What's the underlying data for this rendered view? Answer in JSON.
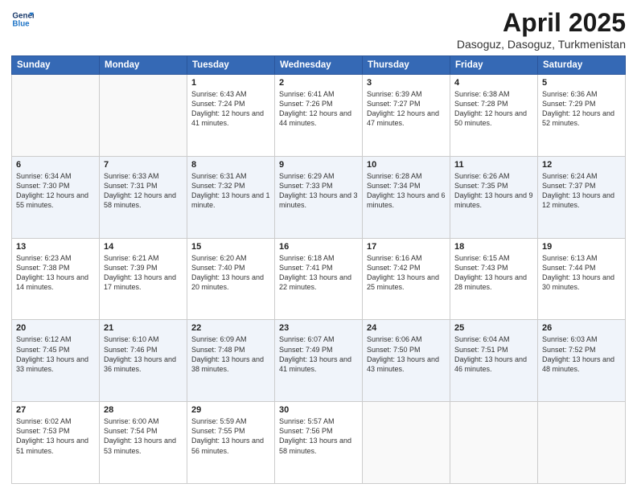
{
  "header": {
    "logo_line1": "General",
    "logo_line2": "Blue",
    "title": "April 2025",
    "subtitle": "Dasoguz, Dasoguz, Turkmenistan"
  },
  "weekdays": [
    "Sunday",
    "Monday",
    "Tuesday",
    "Wednesday",
    "Thursday",
    "Friday",
    "Saturday"
  ],
  "weeks": [
    [
      {
        "day": "",
        "sunrise": "",
        "sunset": "",
        "daylight": ""
      },
      {
        "day": "",
        "sunrise": "",
        "sunset": "",
        "daylight": ""
      },
      {
        "day": "1",
        "sunrise": "Sunrise: 6:43 AM",
        "sunset": "Sunset: 7:24 PM",
        "daylight": "Daylight: 12 hours and 41 minutes."
      },
      {
        "day": "2",
        "sunrise": "Sunrise: 6:41 AM",
        "sunset": "Sunset: 7:26 PM",
        "daylight": "Daylight: 12 hours and 44 minutes."
      },
      {
        "day": "3",
        "sunrise": "Sunrise: 6:39 AM",
        "sunset": "Sunset: 7:27 PM",
        "daylight": "Daylight: 12 hours and 47 minutes."
      },
      {
        "day": "4",
        "sunrise": "Sunrise: 6:38 AM",
        "sunset": "Sunset: 7:28 PM",
        "daylight": "Daylight: 12 hours and 50 minutes."
      },
      {
        "day": "5",
        "sunrise": "Sunrise: 6:36 AM",
        "sunset": "Sunset: 7:29 PM",
        "daylight": "Daylight: 12 hours and 52 minutes."
      }
    ],
    [
      {
        "day": "6",
        "sunrise": "Sunrise: 6:34 AM",
        "sunset": "Sunset: 7:30 PM",
        "daylight": "Daylight: 12 hours and 55 minutes."
      },
      {
        "day": "7",
        "sunrise": "Sunrise: 6:33 AM",
        "sunset": "Sunset: 7:31 PM",
        "daylight": "Daylight: 12 hours and 58 minutes."
      },
      {
        "day": "8",
        "sunrise": "Sunrise: 6:31 AM",
        "sunset": "Sunset: 7:32 PM",
        "daylight": "Daylight: 13 hours and 1 minute."
      },
      {
        "day": "9",
        "sunrise": "Sunrise: 6:29 AM",
        "sunset": "Sunset: 7:33 PM",
        "daylight": "Daylight: 13 hours and 3 minutes."
      },
      {
        "day": "10",
        "sunrise": "Sunrise: 6:28 AM",
        "sunset": "Sunset: 7:34 PM",
        "daylight": "Daylight: 13 hours and 6 minutes."
      },
      {
        "day": "11",
        "sunrise": "Sunrise: 6:26 AM",
        "sunset": "Sunset: 7:35 PM",
        "daylight": "Daylight: 13 hours and 9 minutes."
      },
      {
        "day": "12",
        "sunrise": "Sunrise: 6:24 AM",
        "sunset": "Sunset: 7:37 PM",
        "daylight": "Daylight: 13 hours and 12 minutes."
      }
    ],
    [
      {
        "day": "13",
        "sunrise": "Sunrise: 6:23 AM",
        "sunset": "Sunset: 7:38 PM",
        "daylight": "Daylight: 13 hours and 14 minutes."
      },
      {
        "day": "14",
        "sunrise": "Sunrise: 6:21 AM",
        "sunset": "Sunset: 7:39 PM",
        "daylight": "Daylight: 13 hours and 17 minutes."
      },
      {
        "day": "15",
        "sunrise": "Sunrise: 6:20 AM",
        "sunset": "Sunset: 7:40 PM",
        "daylight": "Daylight: 13 hours and 20 minutes."
      },
      {
        "day": "16",
        "sunrise": "Sunrise: 6:18 AM",
        "sunset": "Sunset: 7:41 PM",
        "daylight": "Daylight: 13 hours and 22 minutes."
      },
      {
        "day": "17",
        "sunrise": "Sunrise: 6:16 AM",
        "sunset": "Sunset: 7:42 PM",
        "daylight": "Daylight: 13 hours and 25 minutes."
      },
      {
        "day": "18",
        "sunrise": "Sunrise: 6:15 AM",
        "sunset": "Sunset: 7:43 PM",
        "daylight": "Daylight: 13 hours and 28 minutes."
      },
      {
        "day": "19",
        "sunrise": "Sunrise: 6:13 AM",
        "sunset": "Sunset: 7:44 PM",
        "daylight": "Daylight: 13 hours and 30 minutes."
      }
    ],
    [
      {
        "day": "20",
        "sunrise": "Sunrise: 6:12 AM",
        "sunset": "Sunset: 7:45 PM",
        "daylight": "Daylight: 13 hours and 33 minutes."
      },
      {
        "day": "21",
        "sunrise": "Sunrise: 6:10 AM",
        "sunset": "Sunset: 7:46 PM",
        "daylight": "Daylight: 13 hours and 36 minutes."
      },
      {
        "day": "22",
        "sunrise": "Sunrise: 6:09 AM",
        "sunset": "Sunset: 7:48 PM",
        "daylight": "Daylight: 13 hours and 38 minutes."
      },
      {
        "day": "23",
        "sunrise": "Sunrise: 6:07 AM",
        "sunset": "Sunset: 7:49 PM",
        "daylight": "Daylight: 13 hours and 41 minutes."
      },
      {
        "day": "24",
        "sunrise": "Sunrise: 6:06 AM",
        "sunset": "Sunset: 7:50 PM",
        "daylight": "Daylight: 13 hours and 43 minutes."
      },
      {
        "day": "25",
        "sunrise": "Sunrise: 6:04 AM",
        "sunset": "Sunset: 7:51 PM",
        "daylight": "Daylight: 13 hours and 46 minutes."
      },
      {
        "day": "26",
        "sunrise": "Sunrise: 6:03 AM",
        "sunset": "Sunset: 7:52 PM",
        "daylight": "Daylight: 13 hours and 48 minutes."
      }
    ],
    [
      {
        "day": "27",
        "sunrise": "Sunrise: 6:02 AM",
        "sunset": "Sunset: 7:53 PM",
        "daylight": "Daylight: 13 hours and 51 minutes."
      },
      {
        "day": "28",
        "sunrise": "Sunrise: 6:00 AM",
        "sunset": "Sunset: 7:54 PM",
        "daylight": "Daylight: 13 hours and 53 minutes."
      },
      {
        "day": "29",
        "sunrise": "Sunrise: 5:59 AM",
        "sunset": "Sunset: 7:55 PM",
        "daylight": "Daylight: 13 hours and 56 minutes."
      },
      {
        "day": "30",
        "sunrise": "Sunrise: 5:57 AM",
        "sunset": "Sunset: 7:56 PM",
        "daylight": "Daylight: 13 hours and 58 minutes."
      },
      {
        "day": "",
        "sunrise": "",
        "sunset": "",
        "daylight": ""
      },
      {
        "day": "",
        "sunrise": "",
        "sunset": "",
        "daylight": ""
      },
      {
        "day": "",
        "sunrise": "",
        "sunset": "",
        "daylight": ""
      }
    ]
  ]
}
